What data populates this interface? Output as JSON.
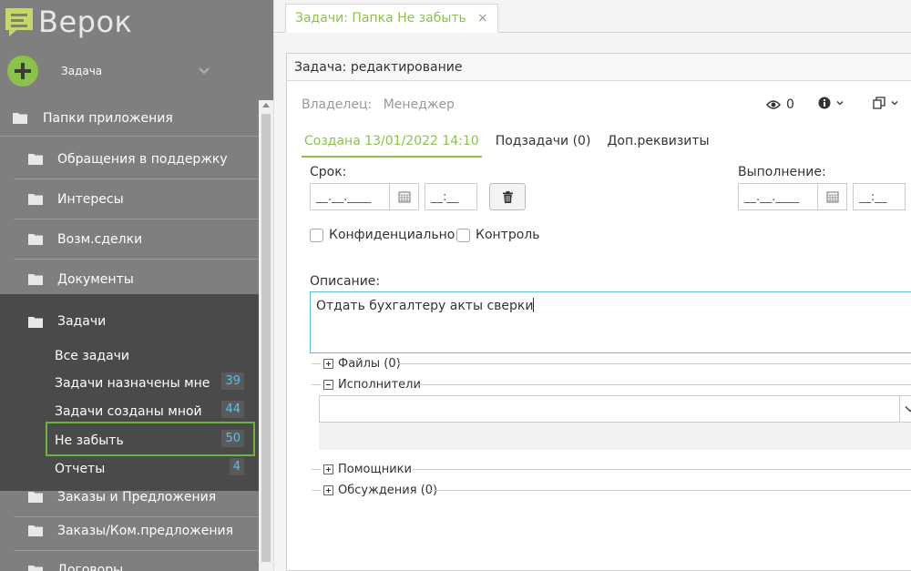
{
  "app": {
    "logo_text": "Верок"
  },
  "quick_add": {
    "label": "Задача"
  },
  "sidebar": {
    "header": "Папки приложения",
    "folders_top": [
      {
        "label": "Обращения в поддержку"
      },
      {
        "label": "Интересы"
      },
      {
        "label": "Возм.сделки"
      },
      {
        "label": "Документы"
      }
    ],
    "expanded_folder": {
      "label": "Задачи",
      "items": [
        {
          "label": "Все задачи",
          "badge": ""
        },
        {
          "label": "Задачи назначены мне",
          "badge": "39"
        },
        {
          "label": "Задачи созданы мной",
          "badge": "44"
        },
        {
          "label": "Не забыть",
          "badge": "50"
        },
        {
          "label": "Отчеты",
          "badge": "4"
        }
      ]
    },
    "folders_bottom": [
      {
        "label": "Заказы и Предложения"
      },
      {
        "label": "Заказы/Ком.предложения"
      },
      {
        "label": "Договоры"
      }
    ]
  },
  "tabs": [
    {
      "label": "Задачи: Папка Не забыть",
      "close": "×"
    }
  ],
  "panel": {
    "title": "Задача: редактирование",
    "owner_label": "Владелец:",
    "owner_value": "Менеджер",
    "views_count": "0",
    "inner_tabs": [
      {
        "label": "Создана 13/01/2022 14:10"
      },
      {
        "label": "Подзадачи (0)"
      },
      {
        "label": "Доп.реквизиты"
      }
    ],
    "deadline": {
      "label": "Срок:",
      "date_placeholder": "__.__.____",
      "time_placeholder": "__:__"
    },
    "completion": {
      "label": "Выполнение:",
      "date_placeholder": "__.__.____",
      "time_placeholder": "__:__"
    },
    "checkboxes": [
      {
        "label": "Конфиденциально",
        "checked": false
      },
      {
        "label": "Контроль",
        "checked": false
      }
    ],
    "description": {
      "label": "Описание:",
      "value": "Отдать бухгалтеру акты сверки"
    },
    "sections": {
      "files": "Файлы (0)",
      "executors": "Исполнители",
      "helpers": "Помощники",
      "discussions": "Обсуждения (0)"
    }
  },
  "colors": {
    "accent": "#8bc34a",
    "sidebar_bg": "#7f7f7f",
    "sidebar_expanded_bg": "#4a4a4a",
    "badge_text": "#4fc3f7",
    "focus_border": "#5bc0de"
  }
}
